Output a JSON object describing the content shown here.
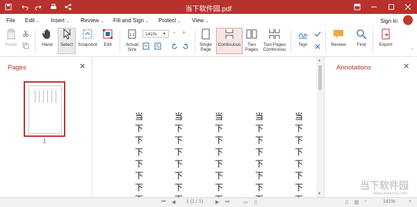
{
  "window": {
    "title": "当下软件园.pdf"
  },
  "menu": {
    "items": [
      {
        "label": "File",
        "caret": false
      },
      {
        "label": "Edit",
        "caret": true
      },
      {
        "label": "Insert",
        "caret": true
      },
      {
        "label": "Review",
        "caret": true
      },
      {
        "label": "Fill and Sign",
        "caret": true
      },
      {
        "label": "Protect",
        "caret": true
      },
      {
        "label": "View",
        "caret": true
      }
    ],
    "signin": "Sign In"
  },
  "ribbon": {
    "paste": "Paste",
    "hand": "Hand",
    "select": "Select",
    "snapshot": "Snapshot",
    "edit": "Edit",
    "actual_size": "Actual Size",
    "zoom": "141%",
    "single_page": "Single Page",
    "continuous": "Continuous",
    "two_pages": "Two Pages",
    "two_pages_continuous": "Two Pages Continuous",
    "sign": "Sign",
    "review": "Review",
    "find": "Find",
    "export": "Export"
  },
  "left_panel": {
    "title": "Pages",
    "page_number": "1"
  },
  "right_panel": {
    "title": "Annotations"
  },
  "document": {
    "char_top": "当",
    "char_bottom": "下"
  },
  "status": {
    "page": "1 (1 / 1)",
    "zoom": "141%"
  },
  "watermark": {
    "text": "当下软件园",
    "sub": "www.downxia.com"
  },
  "colors": {
    "accent": "#b7322c"
  }
}
